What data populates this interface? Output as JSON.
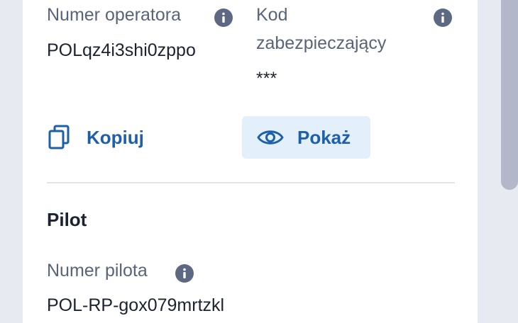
{
  "operator": {
    "number_label": "Numer operatora",
    "number_value": "POLqz4i3shi0zppo",
    "code_label_line1": "Kod",
    "code_label_line2": "zabezpieczający",
    "code_value": "***",
    "copy_label": "Kopiuj",
    "show_label": "Pokaż"
  },
  "pilot": {
    "section_title": "Pilot",
    "number_label": "Numer pilota",
    "number_value": "POL-RP-gox079mrtzkl"
  },
  "colors": {
    "accent": "#1d5fa9",
    "show_button_bg": "#e3f0fb",
    "info_icon": "#5d6883",
    "label": "#5a6479",
    "value": "#1c2230"
  },
  "icons": {
    "info": "info-icon",
    "copy": "copy-icon",
    "eye": "eye-icon"
  }
}
